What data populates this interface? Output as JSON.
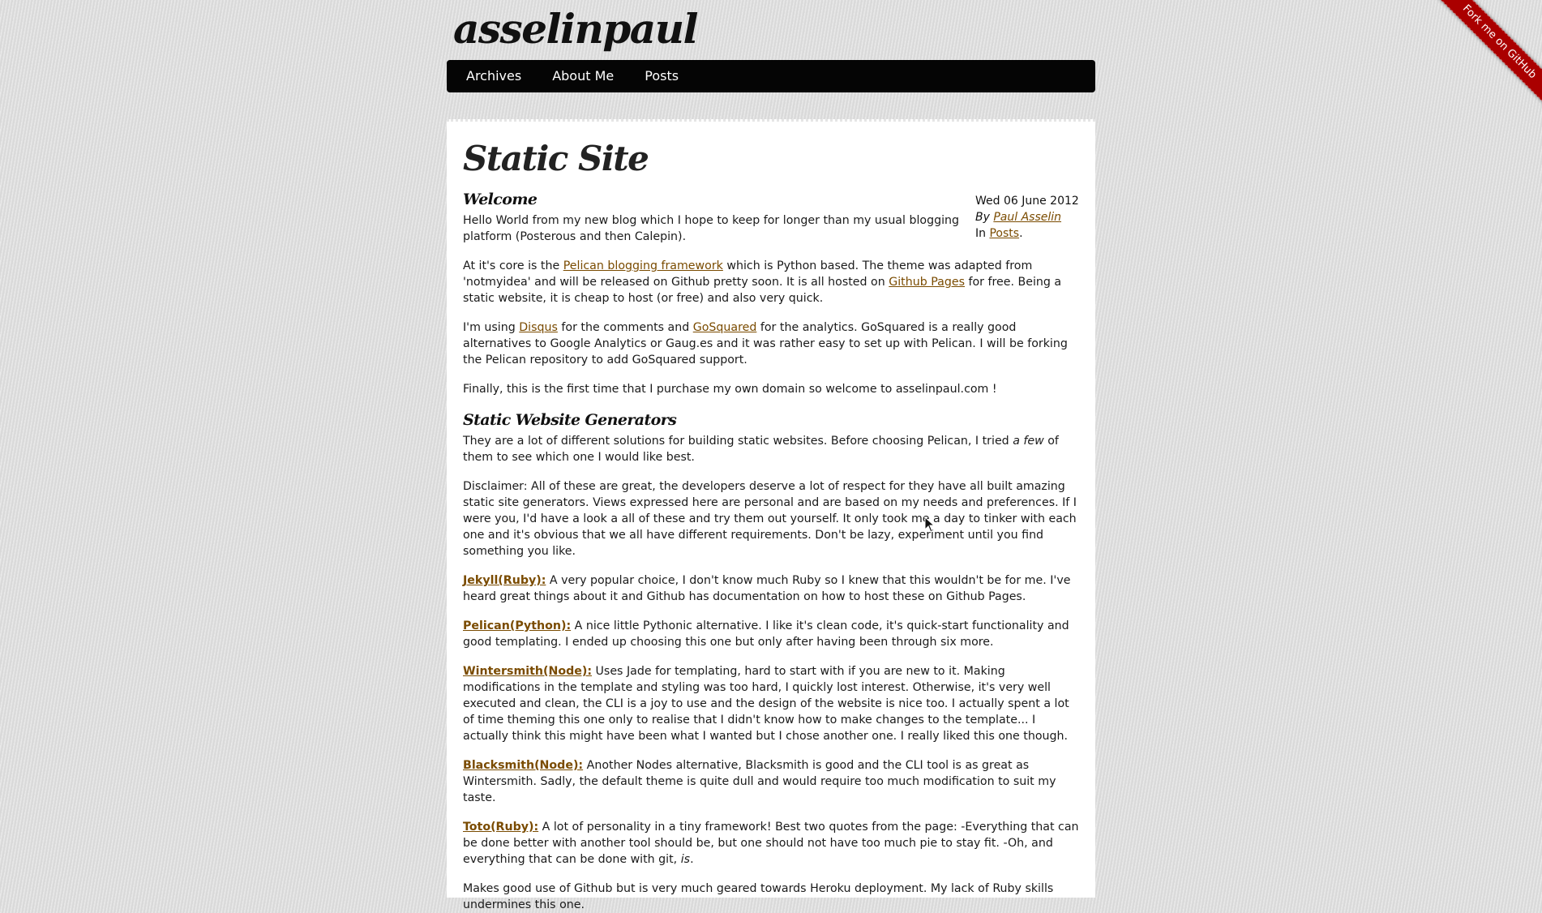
{
  "site": {
    "title": "asselinpaul"
  },
  "nav": {
    "items": [
      "Archives",
      "About Me",
      "Posts"
    ]
  },
  "ribbon": "Fork me on GitHub",
  "page": {
    "title": "Static Site"
  },
  "meta": {
    "date": "Wed 06 June 2012",
    "by": "By",
    "author": "Paul Asselin",
    "in": "In",
    "category": "Posts"
  },
  "article": {
    "h_welcome": "Welcome",
    "p1": "Hello World from my new blog which I hope to keep for longer than my usual blogging platform (Posterous and then Calepin).",
    "p2": {
      "a": "At it's core is the ",
      "link1": "Pelican blogging framework",
      "b": " which is Python based. The theme was adapted from 'notmyidea' and will be released on Github pretty soon. It is all hosted on ",
      "link2": "Github Pages",
      "c": " for free. Being a static website, it is cheap to host (or free) and also very quick."
    },
    "p3": {
      "a": "I'm using ",
      "link1": "Disqus",
      "b": " for the comments and ",
      "link2": "GoSquared",
      "c": " for the analytics. GoSquared is a really good alternatives to Google Analytics or Gaug.es and it was rather easy to set up with Pelican. I will be forking the Pelican repository to add GoSquared support."
    },
    "p4": "Finally, this is the first time that I purchase my own domain so welcome to asselinpaul.com !",
    "h_generators": "Static Website Generators",
    "p5": {
      "a": "They are a lot of different solutions for building static websites. Before choosing Pelican, I tried ",
      "em": "a few",
      "b": " of them to see which one I would like best."
    },
    "p6": "Disclaimer: All of these are great, the developers deserve a lot of respect for they have all built amazing static site generators. Views expressed here are personal and are based on my needs and preferences. If I were you, I'd have a look a all of these and try them out yourself. It only took me a day to tinker with each one and it's obvious that we all have different requirements. Don't be lazy, experiment until you find something you like.",
    "jekyll": {
      "label": "Jekyll(Ruby):",
      "text": " A very popular choice, I don't know much Ruby so I knew that this wouldn't be for me. I've heard great things about it and Github has documentation on how to host these on Github Pages."
    },
    "pelican": {
      "label": "Pelican(Python):",
      "text": " A nice little Pythonic alternative. I like it's clean code, it's quick-start functionality and good templating. I ended up choosing this one but only after having been through six more."
    },
    "wintersmith": {
      "label": "Wintersmith(Node):",
      "text": " Uses Jade for templating, hard to start with if you are new to it. Making modifications in the template and styling was too hard, I quickly lost interest. Otherwise, it's very well executed and clean, the CLI is a joy to use and the design of the website is nice too. I actually spent a lot of time theming this one only to realise that I didn't know how to make changes to the template... I actually think this might have been what I wanted but I chose another one. I really liked this one though."
    },
    "blacksmith": {
      "label": "Blacksmith(Node):",
      "text": " Another Nodes alternative, Blacksmith is good and the CLI tool is as great as Wintersmith. Sadly, the default theme is quite dull and would require too much modification to suit my taste."
    },
    "toto": {
      "label": "Toto(Ruby):",
      "text": " A lot of personality in a tiny framework! Best two quotes from the page: -Everything that can be done better with another tool should be, but one should not have too much pie to stay fit. -Oh, and everything that can be done with git, ",
      "em": "is",
      "end": "."
    },
    "p_last": "Makes good use of Github but is very much geared towards Heroku deployment. My lack of Ruby skills undermines this one."
  }
}
